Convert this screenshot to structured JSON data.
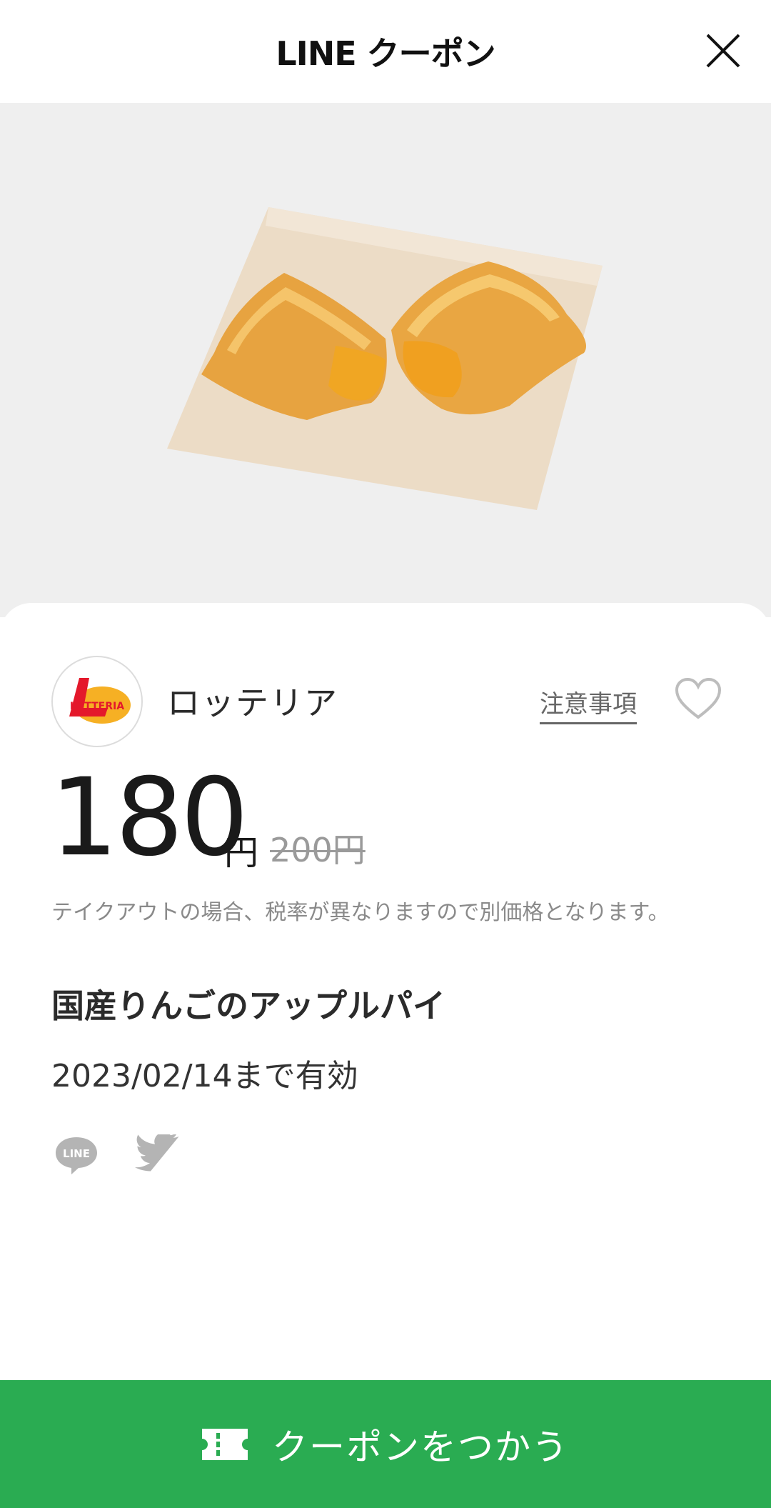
{
  "header": {
    "title": "LINE クーポン",
    "close_icon": "close-icon"
  },
  "hero": {
    "image": "apple-pie-photo"
  },
  "shop": {
    "name": "ロッテリア",
    "logo_text": "LOTTERIA",
    "notes_label": "注意事項",
    "favorite_icon": "heart-outline-icon"
  },
  "price": {
    "value": "180",
    "unit": "円",
    "original": "200円"
  },
  "note": "テイクアウトの場合、税率が異なりますので別価格となります。",
  "product": {
    "name": "国産りんごのアップルパイ"
  },
  "validity": "2023/02/14まで有効",
  "share": {
    "line_text": "LINE",
    "twitter_icon": "twitter-icon"
  },
  "cta": {
    "label": "クーポンをつかう",
    "icon": "ticket-icon",
    "color": "#2aac52"
  }
}
